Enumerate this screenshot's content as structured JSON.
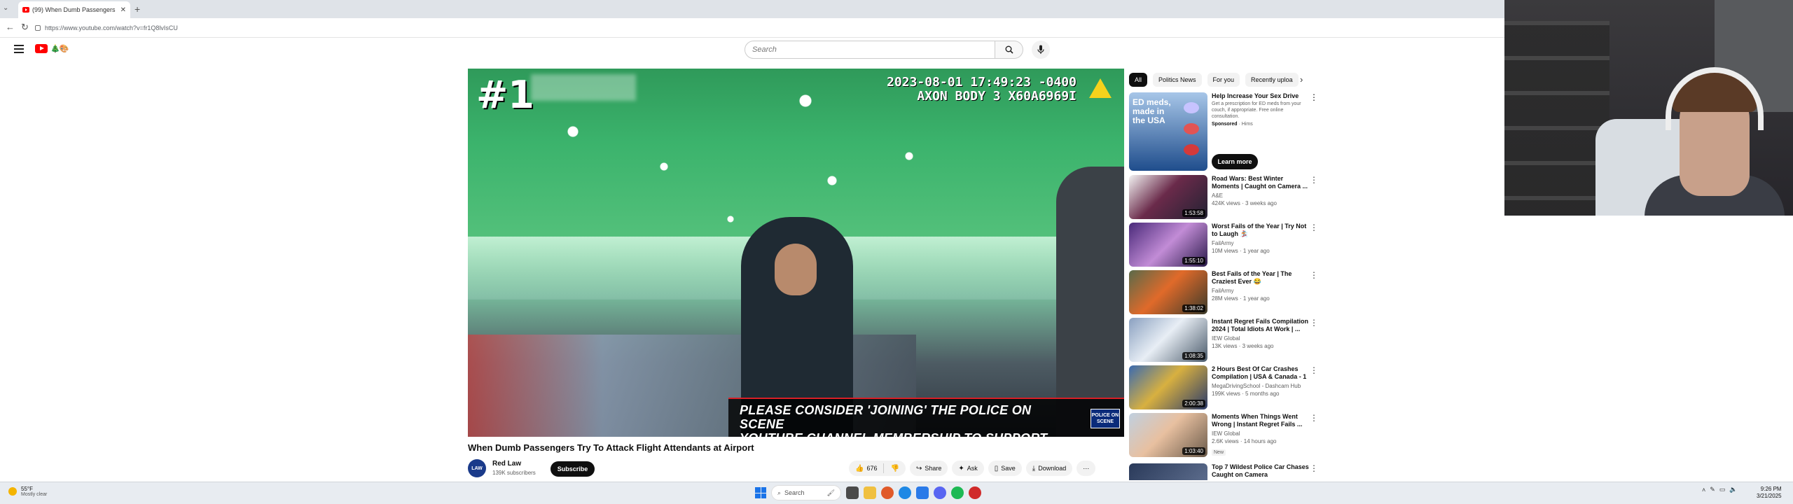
{
  "browser": {
    "tab_title": "(99) When Dumb Passengers",
    "url": "https://www.youtube.com/watch?v=fr1Q8lvIsCU"
  },
  "header": {
    "search_placeholder": "Search"
  },
  "video": {
    "rank_overlay": "#1",
    "timestamp": "2023-08-01 17:49:23 -0400",
    "camera_id": "AXON BODY 3 X60A6969I",
    "banner_line1": "PLEASE CONSIDER 'JOINING' THE POLICE ON SCENE",
    "banner_line2": "YOUTUBE CHANNEL MEMBERSHIP TO SUPPORT THE CHANNEL!",
    "banner_logo": "POLICE ON SCENE",
    "title": "When Dumb Passengers Try To Attack Flight Attendants at Airport",
    "channel": "Red Law",
    "channel_avatar": "LAW",
    "subscribers": "139K subscribers",
    "subscribe_label": "Subscribe",
    "like_count": "676",
    "share_label": "Share",
    "ask_label": "Ask",
    "save_label": "Save",
    "download_label": "Download"
  },
  "chips": [
    "All",
    "Politics News",
    "For you",
    "Recently uploa"
  ],
  "ad": {
    "title": "Help Increase Your Sex Drive",
    "description": "Get a prescription for ED meds from your couch, if appropriate. Free online consultation.",
    "sponsored": "Sponsored",
    "advertiser": "· Hims",
    "thumb_text": "ED meds, made in the USA",
    "cta": "Learn more"
  },
  "recommendations": [
    {
      "title": "Road Wars: Best Winter Moments | Caught on Camera ...",
      "channel": "A&E",
      "meta": "424K views · 3 weeks ago",
      "duration": "1:53:58"
    },
    {
      "title": "Worst Fails of the Year | Try Not to Laugh 🏂",
      "channel": "FailArmy",
      "meta": "10M views · 1 year ago",
      "duration": "1:55:10"
    },
    {
      "title": "Best Fails of the Year | The Craziest Ever 😂",
      "channel": "FailArmy",
      "meta": "28M views · 1 year ago",
      "duration": "1:38:02"
    },
    {
      "title": "Instant Regret Fails Compilation 2024 | Total Idiots At Work | ...",
      "channel": "IEW Global",
      "meta": "13K views · 3 weeks ago",
      "duration": "1:08:35"
    },
    {
      "title": "2 Hours Best Of Car Crashes Compilation | USA & Canada - 1",
      "channel": "MegaDrivingSchool - Dashcam Hub",
      "meta": "199K views · 5 months ago",
      "duration": "2:00:38"
    },
    {
      "title": "Moments When Things Went Wrong | Instant Regret Fails ...",
      "channel": "IEW Global",
      "meta": "2.6K views · 14 hours ago",
      "duration": "1:03:40",
      "badge": "New"
    },
    {
      "title": "Top 7 Wildest Police Car Chases Caught on Camera",
      "channel": "",
      "meta": "",
      "duration": ""
    }
  ],
  "taskbar": {
    "temp": "55°F",
    "weather": "Mostly clear",
    "search": "Search",
    "time": "9:26 PM",
    "date": "3/21/2025"
  }
}
